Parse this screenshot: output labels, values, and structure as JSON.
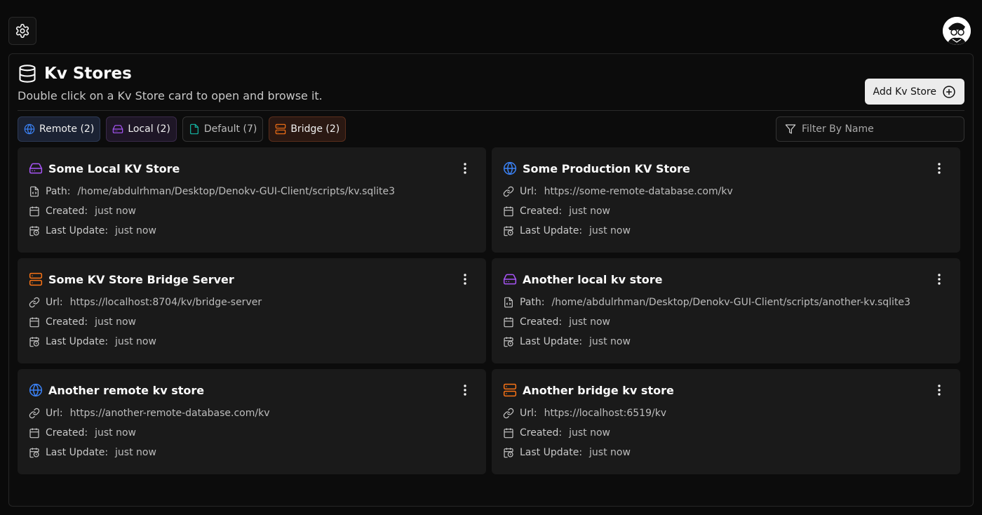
{
  "header": {
    "title": "Kv Stores",
    "subtitle": "Double click on a Kv Store card to open and browse it.",
    "add_label": "Add Kv Store"
  },
  "tabs": [
    {
      "label": "Remote (2)",
      "kind": "remote",
      "color": "#3b82f6"
    },
    {
      "label": "Local (2)",
      "kind": "local",
      "color": "#a855f7"
    },
    {
      "label": "Default (7)",
      "kind": "default",
      "color": "#14b8a6"
    },
    {
      "label": "Bridge (2)",
      "kind": "bridge",
      "color": "#f97316"
    }
  ],
  "filter": {
    "placeholder": "Filter By Name"
  },
  "cards": [
    {
      "name": "Some Local KV Store",
      "kind": "local",
      "first_label": "Path:",
      "first_value": "/home/abdulrhman/Desktop/Denokv-GUI-Client/scripts/kv.sqlite3",
      "created_label": "Created:",
      "created": "just now",
      "updated_label": "Last Update:",
      "updated": "just now"
    },
    {
      "name": "Some Production KV Store",
      "kind": "remote",
      "first_label": "Url:",
      "first_value": "https://some-remote-database.com/kv",
      "created_label": "Created:",
      "created": "just now",
      "updated_label": "Last Update:",
      "updated": "just now"
    },
    {
      "name": "Some KV Store Bridge Server",
      "kind": "bridge",
      "first_label": "Url:",
      "first_value": "https://localhost:8704/kv/bridge-server",
      "created_label": "Created:",
      "created": "just now",
      "updated_label": "Last Update:",
      "updated": "just now"
    },
    {
      "name": "Another local kv store",
      "kind": "local",
      "first_label": "Path:",
      "first_value": "/home/abdulrhman/Desktop/Denokv-GUI-Client/scripts/another-kv.sqlite3",
      "created_label": "Created:",
      "created": "just now",
      "updated_label": "Last Update:",
      "updated": "just now"
    },
    {
      "name": "Another remote kv store",
      "kind": "remote",
      "first_label": "Url:",
      "first_value": "https://another-remote-database.com/kv",
      "created_label": "Created:",
      "created": "just now",
      "updated_label": "Last Update:",
      "updated": "just now"
    },
    {
      "name": "Another bridge kv store",
      "kind": "bridge",
      "first_label": "Url:",
      "first_value": "https://localhost:6519/kv",
      "created_label": "Created:",
      "created": "just now",
      "updated_label": "Last Update:",
      "updated": "just now"
    }
  ]
}
